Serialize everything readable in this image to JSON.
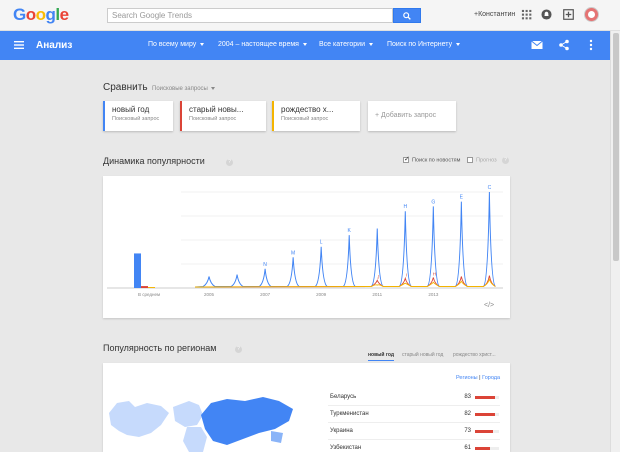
{
  "gbar": {
    "logo_letters": [
      "G",
      "o",
      "o",
      "g",
      "l",
      "e"
    ],
    "logo_colors": [
      "#4285f4",
      "#ea4335",
      "#fbbc05",
      "#4285f4",
      "#34a853",
      "#ea4335"
    ],
    "search_placeholder": "Search Google Trends",
    "user_name": "+Константин",
    "icons": [
      "apps-icon",
      "notifications-icon",
      "share-plus-icon",
      "avatar"
    ]
  },
  "header": {
    "title": "Анализ",
    "filters": [
      "По всему миру",
      "2004 – настоящее время",
      "Все категории",
      "Поиск по Интернету"
    ],
    "icons": [
      "email-icon",
      "share-icon",
      "more-vert-icon"
    ],
    "color": "#4285f4"
  },
  "compare": {
    "title": "Сравнить",
    "subtitle": "Поисковые запросы",
    "terms": [
      {
        "label": "новый год",
        "type": "Поисковый запрос",
        "color": "#4285f4"
      },
      {
        "label": "старый новы...",
        "type": "Поисковый запрос",
        "color": "#db4437"
      },
      {
        "label": "рождество х...",
        "type": "Поисковый запрос",
        "color": "#f4b400"
      }
    ],
    "add_label": "+ Добавить запрос"
  },
  "interest": {
    "title": "Динамика популярности",
    "news_label": "Поиск по новостям",
    "news_checked": true,
    "forecast_label": "Прогноз",
    "forecast_checked": false,
    "embed_icon": "code-embed-icon"
  },
  "chart_data": {
    "type": "line",
    "average_label": "В среднем",
    "average_values": [
      36,
      2,
      1
    ],
    "x_ticks": [
      "2005",
      "2007",
      "2009",
      "2011",
      "2013"
    ],
    "annotations": [
      "N",
      "M",
      "L",
      "K",
      "J",
      "I",
      "H",
      "G",
      "E",
      "C"
    ],
    "series": [
      {
        "name": "новый год",
        "color": "#4285f4",
        "peaks": [
          {
            "x": 2005.0,
            "y": 12
          },
          {
            "x": 2006.0,
            "y": 14
          },
          {
            "x": 2007.0,
            "y": 20
          },
          {
            "x": 2008.0,
            "y": 32
          },
          {
            "x": 2009.0,
            "y": 43
          },
          {
            "x": 2010.0,
            "y": 55
          },
          {
            "x": 2011.0,
            "y": 62
          },
          {
            "x": 2012.0,
            "y": 80
          },
          {
            "x": 2013.0,
            "y": 85
          },
          {
            "x": 2014.0,
            "y": 90
          },
          {
            "x": 2015.0,
            "y": 100
          }
        ]
      },
      {
        "name": "старый новы...",
        "color": "#db4437",
        "peaks": [
          {
            "x": 2011.0,
            "y": 8
          },
          {
            "x": 2012.0,
            "y": 10
          },
          {
            "x": 2013.0,
            "y": 11
          },
          {
            "x": 2014.0,
            "y": 12
          },
          {
            "x": 2015.0,
            "y": 13
          }
        ]
      },
      {
        "name": "рождество х...",
        "color": "#f4b400",
        "peaks": [
          {
            "x": 2011.0,
            "y": 3
          },
          {
            "x": 2012.0,
            "y": 5
          },
          {
            "x": 2013.0,
            "y": 6
          },
          {
            "x": 2014.0,
            "y": 7
          },
          {
            "x": 2015.0,
            "y": 9
          }
        ]
      }
    ]
  },
  "regions": {
    "title": "Популярность по регионам",
    "tabs": [
      "новый год",
      "старый новый год",
      "рождество христ..."
    ],
    "toggle_regions": "Регионы",
    "toggle_sep": "|",
    "toggle_cities": "Города",
    "rows": [
      {
        "name": "Беларусь",
        "value": 83
      },
      {
        "name": "Туркменистан",
        "value": 82
      },
      {
        "name": "Украина",
        "value": 73
      },
      {
        "name": "Узбекистан",
        "value": 61
      }
    ],
    "bar_color": "#db4437"
  }
}
